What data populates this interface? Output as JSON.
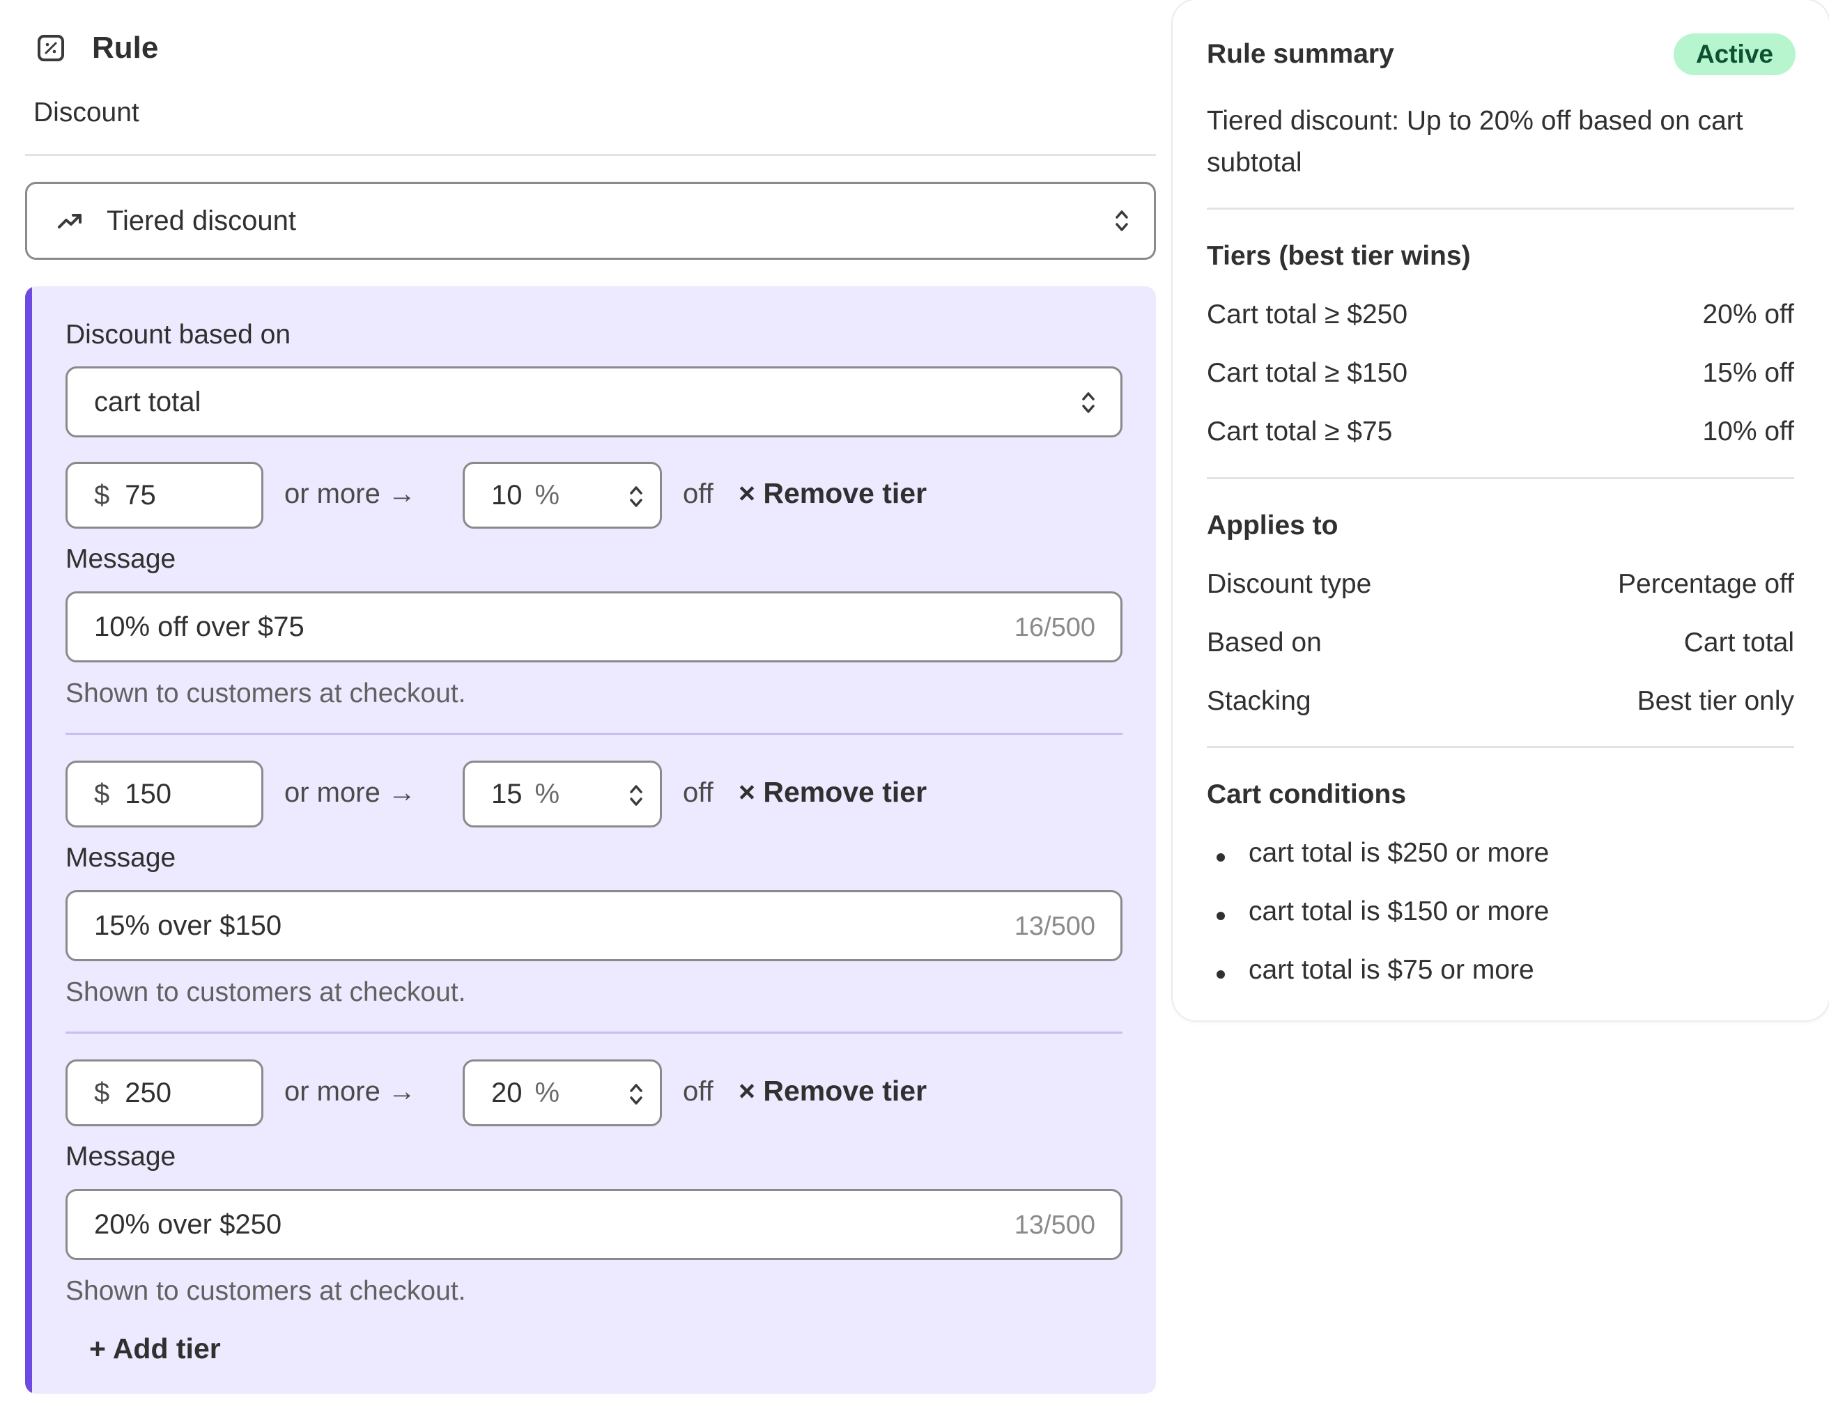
{
  "header": {
    "icon": "percent-badge-icon",
    "title": "Rule",
    "subtitle": "Discount"
  },
  "discount_type": {
    "icon": "trending-up-icon",
    "selected": "Tiered discount"
  },
  "tiers_panel": {
    "based_on_label": "Discount based on",
    "based_on_value": "cart total",
    "or_more_text": "or more →",
    "currency_symbol": "$",
    "percent_symbol": "%",
    "off_text": "off",
    "remove_label": "× Remove tier",
    "message_label": "Message",
    "help_text": "Shown to customers at checkout.",
    "add_tier_label": "+ Add tier",
    "tiers": [
      {
        "amount": "75",
        "percent": "10",
        "message": "10% off over $75",
        "count": "16/500"
      },
      {
        "amount": "150",
        "percent": "15",
        "message": "15% over $150",
        "count": "13/500"
      },
      {
        "amount": "250",
        "percent": "20",
        "message": "20% over $250",
        "count": "13/500"
      }
    ]
  },
  "summary": {
    "title": "Rule summary",
    "status": "Active",
    "status_color": "#b7f5cf",
    "description": "Tiered discount: Up to 20% off based on cart subtotal",
    "tiers_title": "Tiers (best tier wins)",
    "tiers": [
      {
        "condition": "Cart total ≥ $250",
        "discount": "20% off"
      },
      {
        "condition": "Cart total ≥ $150",
        "discount": "15% off"
      },
      {
        "condition": "Cart total ≥ $75",
        "discount": "10% off"
      }
    ],
    "applies_title": "Applies to",
    "applies": [
      {
        "key": "Discount type",
        "value": "Percentage off"
      },
      {
        "key": "Based on",
        "value": "Cart total"
      },
      {
        "key": "Stacking",
        "value": "Best tier only"
      }
    ],
    "conditions_title": "Cart conditions",
    "conditions": [
      "cart total is $250 or more",
      "cart total is $150 or more",
      "cart total is $75 or more"
    ]
  },
  "colors": {
    "panel_background": "#ede9fe",
    "panel_accent": "#6d4be3"
  }
}
